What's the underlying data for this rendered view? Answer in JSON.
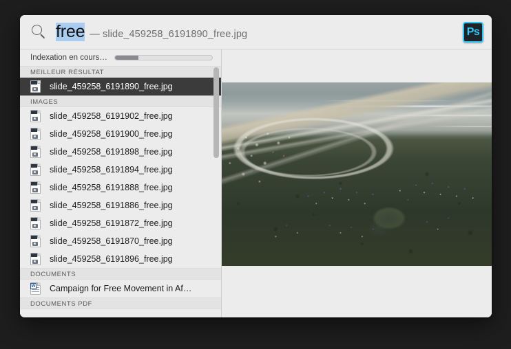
{
  "window": {
    "title": "Spotlight"
  },
  "search": {
    "icon": "search-icon",
    "query": "free",
    "separator": "—",
    "completion": "slide_459258_6191890_free.jpg",
    "app_icon_label": "Ps",
    "app_icon_name": "photoshop-icon",
    "app_accent_color": "#34c8f5"
  },
  "indexing": {
    "label": "Indexation en cours…",
    "progress_percent": 24
  },
  "sections": [
    {
      "header": "MEILLEUR RÉSULTAT",
      "items": [
        {
          "label": "slide_459258_6191890_free.jpg",
          "icon": "jpeg-file-icon",
          "selected": true
        }
      ]
    },
    {
      "header": "IMAGES",
      "items": [
        {
          "label": "slide_459258_6191902_free.jpg",
          "icon": "jpeg-file-icon",
          "selected": false
        },
        {
          "label": "slide_459258_6191900_free.jpg",
          "icon": "jpeg-file-icon",
          "selected": false
        },
        {
          "label": "slide_459258_6191898_free.jpg",
          "icon": "jpeg-file-icon",
          "selected": false
        },
        {
          "label": "slide_459258_6191894_free.jpg",
          "icon": "jpeg-file-icon",
          "selected": false
        },
        {
          "label": "slide_459258_6191888_free.jpg",
          "icon": "jpeg-file-icon",
          "selected": false
        },
        {
          "label": "slide_459258_6191886_free.jpg",
          "icon": "jpeg-file-icon",
          "selected": false
        },
        {
          "label": "slide_459258_6191872_free.jpg",
          "icon": "jpeg-file-icon",
          "selected": false
        },
        {
          "label": "slide_459258_6191870_free.jpg",
          "icon": "jpeg-file-icon",
          "selected": false
        },
        {
          "label": "slide_459258_6191896_free.jpg",
          "icon": "jpeg-file-icon",
          "selected": false
        }
      ]
    },
    {
      "header": "DOCUMENTS",
      "items": [
        {
          "label": "Campaign for Free Movement in Af…",
          "icon": "word-file-icon",
          "selected": false
        }
      ]
    },
    {
      "header": "DOCUMENTS PDF",
      "items": []
    }
  ],
  "preview": {
    "description": "Aerial photograph of a coastline with ocean and breaking surf at top, an industrial town and highway interchange at left, and a large informal tent encampment with blue and white tarpaulins spread across scrubland, plus a small pond"
  },
  "colors": {
    "window_background": "#ececec",
    "section_header_background": "#e3e3e3",
    "selected_row_background": "#3b3b3b",
    "query_highlight": "#a8cdf0",
    "desktop_background": "#1e1e1e"
  }
}
